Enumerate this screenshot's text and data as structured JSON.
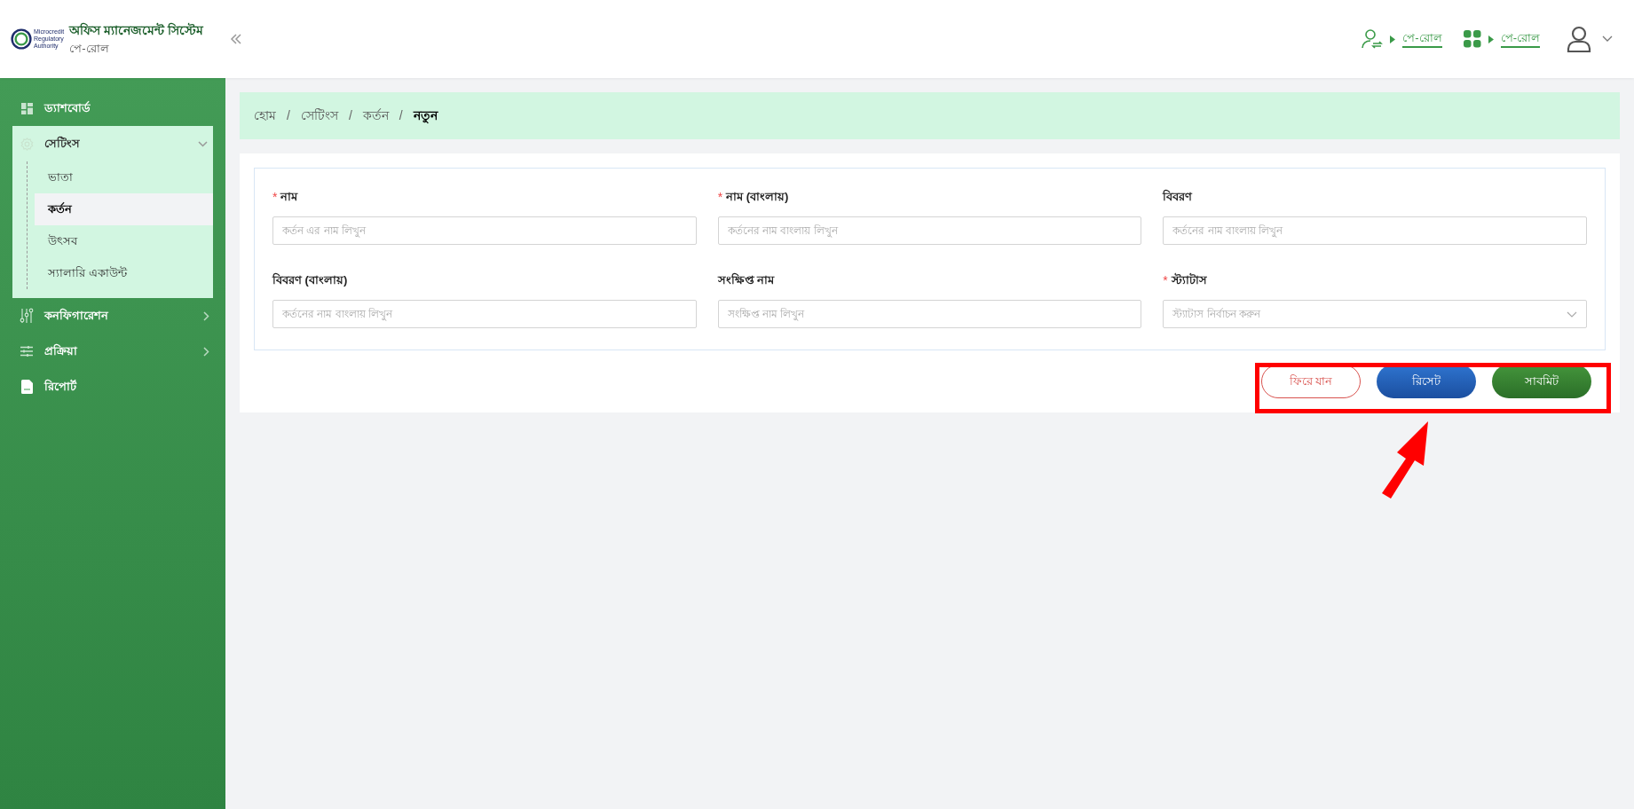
{
  "header": {
    "logo_lines": [
      "Microcredit",
      "Regulatory",
      "Authority"
    ],
    "title": "অফিস ম্যানেজমেন্ট সিস্টেম",
    "subtitle": "পে-রোল",
    "shortcuts": [
      {
        "kind": "user-switch",
        "label": "পে-রোল"
      },
      {
        "kind": "apps",
        "label": "পে-রোল"
      }
    ]
  },
  "sidebar": {
    "items": [
      {
        "kind": "dashboard",
        "label": "ড্যাশবোর্ড"
      },
      {
        "kind": "settings",
        "label": "সেটিংস",
        "expanded": true,
        "children": [
          {
            "label": "ভাতা",
            "selected": false
          },
          {
            "label": "কর্তন",
            "selected": true
          },
          {
            "label": "উৎসব",
            "selected": false
          },
          {
            "label": "স্যালারি একাউন্ট",
            "selected": false
          }
        ]
      },
      {
        "kind": "configuration",
        "label": "কনফিগারেশন",
        "expanded": false
      },
      {
        "kind": "process",
        "label": "প্রক্রিয়া",
        "expanded": false
      },
      {
        "kind": "report",
        "label": "রিপোর্ট"
      }
    ]
  },
  "breadcrumb_separator": "/",
  "breadcrumb": [
    {
      "label": "হোম",
      "current": false
    },
    {
      "label": "সেটিংস",
      "current": false
    },
    {
      "label": "কর্তন",
      "current": false
    },
    {
      "label": "নতুন",
      "current": true
    }
  ],
  "form": {
    "required_mark": "*",
    "fields": [
      {
        "kind": "text",
        "label": "নাম",
        "required": true,
        "placeholder": "কর্তন এর নাম লিখুন"
      },
      {
        "kind": "text",
        "label": "নাম (বাংলায়)",
        "required": true,
        "placeholder": "কর্তনের নাম বাংলায় লিখুন"
      },
      {
        "kind": "text",
        "label": "বিবরণ",
        "required": false,
        "placeholder": "কর্তনের নাম বাংলায় লিখুন"
      },
      {
        "kind": "text",
        "label": "বিবরণ (বাংলায়)",
        "required": false,
        "placeholder": "কর্তনের নাম বাংলায় লিখুন"
      },
      {
        "kind": "text",
        "label": "সংক্ষিপ্ত নাম",
        "required": false,
        "placeholder": "সংক্ষিপ্ত নাম লিখুন"
      },
      {
        "kind": "select",
        "label": "স্ট্যাটাস",
        "required": true,
        "placeholder": "স্ট্যাটাস নির্বাচন করুন"
      }
    ],
    "buttons": [
      {
        "kind": "back",
        "label": "ফিরে যান"
      },
      {
        "kind": "reset",
        "label": "রিসেট"
      },
      {
        "kind": "submit",
        "label": "সাবমিট"
      }
    ]
  }
}
